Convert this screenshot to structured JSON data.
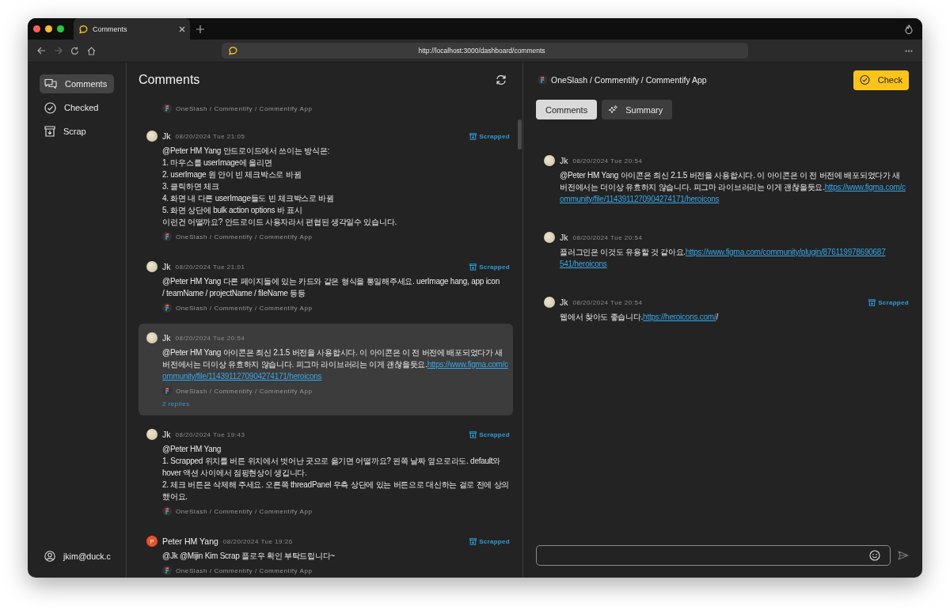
{
  "browser": {
    "tab": {
      "title": "Comments"
    },
    "url": "http://localhost:3000/dashboard/comments"
  },
  "sidebar": {
    "items": [
      {
        "kind": "comments",
        "label": "Comments",
        "selected": true
      },
      {
        "kind": "checked",
        "label": "Checked",
        "selected": false
      },
      {
        "kind": "scrap",
        "label": "Scrap",
        "selected": false
      }
    ],
    "user": "jkim@duck.c"
  },
  "comment_list": {
    "title": "Comments",
    "comments": [
      {
        "project": "OneSlash / Commentify / Commentify App"
      },
      {
        "avatar": {
          "kind": "photo"
        },
        "author": "Jk",
        "date": "08/20/2024 Tue 21:05",
        "scrapped": true,
        "scrap_label": "Scrapped",
        "selected": false,
        "lines": [
          {
            "text": "@Peter HM Yang 안드로이드에서 쓰이는 방식은:"
          },
          {
            "text": "1. 마우스를 userImage에 올리면"
          },
          {
            "text": "2. userImage 원 안이 빈 체크박스로 바뀜"
          },
          {
            "text": "3. 클릭하면 체크"
          },
          {
            "text": "4. 화면 내 다른 userImage들도 빈 체크박스로 바뀜"
          },
          {
            "text": "5. 화면 상단에 bulk action options 바 표시"
          },
          {
            "text": "이런건 어떨까요? 안드로이드 사용자라서 편협된 생각일수 있습니다."
          }
        ],
        "project": "OneSlash / Commentify / Commentify App"
      },
      {
        "avatar": {
          "kind": "photo"
        },
        "author": "Jk",
        "date": "08/20/2024 Tue 21:01",
        "scrapped": true,
        "scrap_label": "Scrapped",
        "selected": false,
        "lines": [
          {
            "text": "@Peter HM Yang 다른 페이지들에 있는 카드와 같은 형식을 통일해주세요. uerImage hang, app icon"
          },
          {
            "text": "/ teamName / projectName / fileName 등등"
          }
        ],
        "project": "OneSlash / Commentify / Commentify App"
      },
      {
        "avatar": {
          "kind": "photo"
        },
        "author": "Jk",
        "date": "08/20/2024 Tue 20:54",
        "scrapped": false,
        "selected": true,
        "lines": [
          {
            "text": "@Peter HM Yang 아이콘은 최신 2.1.5 버전을 사용합시다. 이 아이콘은 이 전 버전에 배포되었다가 새"
          },
          {
            "text": "버전에서는 더이상 유효하지 않습니다. 피그마 라이브러리는 이게 괜찮을듯요.",
            "link": "https://www.figma.com/c"
          },
          {
            "link": "ommunity/file/1143911270904274171/heroicons"
          }
        ],
        "project": "OneSlash / Commentify / Commentify App",
        "replies": "2 replies"
      },
      {
        "avatar": {
          "kind": "photo"
        },
        "author": "Jk",
        "date": "08/20/2024 Tue 19:43",
        "scrapped": true,
        "scrap_label": "Scrapped",
        "selected": false,
        "lines": [
          {
            "text": "@Peter HM Yang"
          },
          {
            "text": "1. Scrapped 위치를 버튼 위치에서 벗어난 곳으로 옮기면 어떨까요? 왼쪽 날짜 옆으로라도. default와"
          },
          {
            "text": "hover 액션 사이에서 점핑현상이 생깁니다."
          },
          {
            "text": "2. 체크 버튼은 삭제해 주세요. 오른쪽 threadPanel 우측 상단에 있는 버튼으로 대신하는 걸로 전에 상의"
          },
          {
            "text": "했어요."
          }
        ],
        "project": "OneSlash / Commentify / Commentify App"
      },
      {
        "avatar": {
          "kind": "initial",
          "text": "P"
        },
        "author": "Peter HM Yang",
        "date": "08/20/2024 Tue 19:26",
        "scrapped": true,
        "scrap_label": "Scrapped",
        "selected": false,
        "lines": [
          {
            "text": "@Jk @Mijin Kim Scrap 플로우 확인 부탁드립니다~"
          }
        ],
        "project": "OneSlash / Commentify / Commentify App"
      }
    ]
  },
  "thread": {
    "breadcrumb": "OneSlash / Commentify / Commentify App",
    "check_button": "Check",
    "tabs": [
      {
        "kind": "plain",
        "label": "Comments",
        "selected": true
      },
      {
        "kind": "sparkle",
        "label": "Summary",
        "selected": false
      }
    ],
    "comments": [
      {
        "avatar": {
          "kind": "photo"
        },
        "author": "Jk",
        "date": "08/20/2024 Tue 20:54",
        "scrapped": false,
        "lines": [
          {
            "text": "@Peter HM Yang 아이콘은 최신 2.1.5 버전을 사용합시다. 이 아이콘은 이 전 버전에 배포되었다가 새"
          },
          {
            "text": "버전에서는 더이상 유효하지 않습니다. 피그마 라이브러리는 이게 괜찮을듯요.",
            "link": "https://www.figma.com/c"
          },
          {
            "link": "ommunity/file/1143911270904274171/heroicons"
          }
        ]
      },
      {
        "avatar": {
          "kind": "photo"
        },
        "author": "Jk",
        "date": "08/20/2024 Tue 20:54",
        "scrapped": false,
        "lines": [
          {
            "text": "플러그인은 이것도 유용할 것 같아요.",
            "link": "https://www.figma.com/community/plugin/876119978690687"
          },
          {
            "link": "541/heroicons"
          }
        ]
      },
      {
        "avatar": {
          "kind": "photo"
        },
        "author": "Jk",
        "date": "08/20/2024 Tue 20:54",
        "scrapped": true,
        "scrap_label": "Scrapped",
        "lines": [
          {
            "text": "웹에서 찾아도 좋습니다.",
            "link": "https://heroicons.com/",
            "after": "/"
          }
        ]
      }
    ]
  }
}
